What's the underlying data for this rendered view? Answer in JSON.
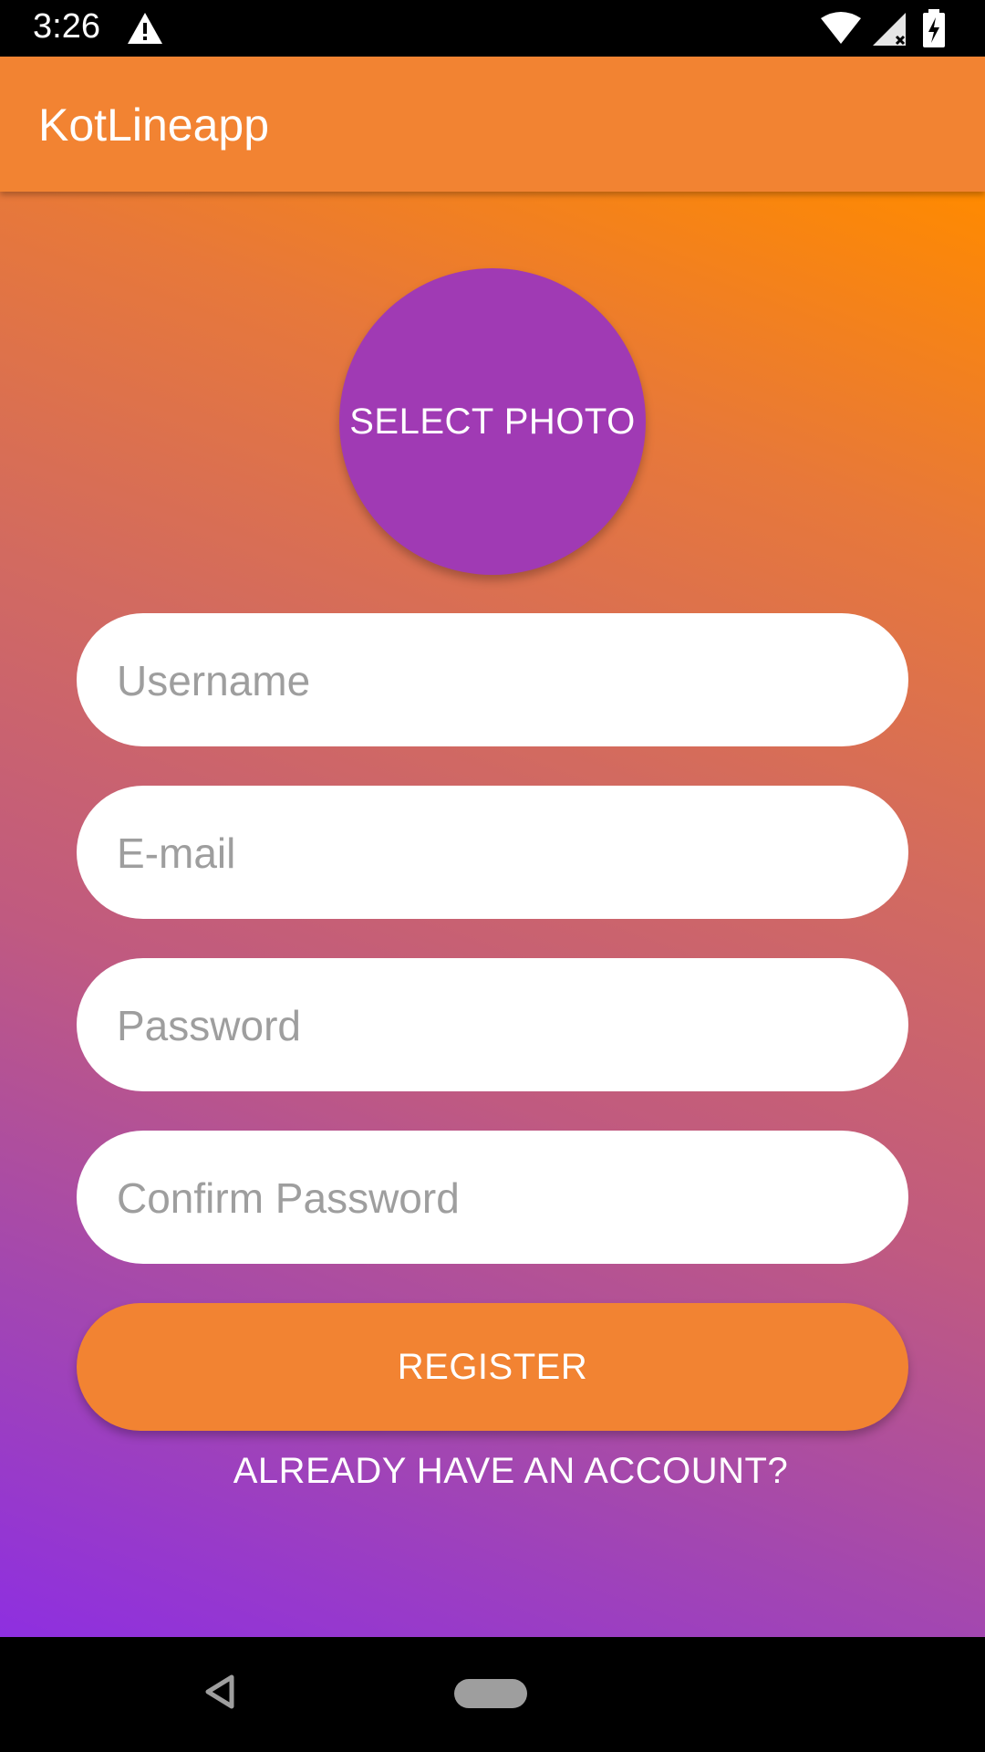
{
  "status_bar": {
    "time": "3:26",
    "icons": [
      "warning-icon",
      "wifi-icon",
      "signal-icon",
      "battery-charging-icon"
    ]
  },
  "app_bar": {
    "title": "KotLineapp"
  },
  "form": {
    "select_photo_label": "SELECT PHOTO",
    "username_placeholder": "Username",
    "email_placeholder": "E-mail",
    "password_placeholder": "Password",
    "confirm_password_placeholder": "Confirm Password",
    "register_label": "REGISTER",
    "login_link_label": "ALREADY HAVE AN ACCOUNT?"
  },
  "colors": {
    "accent": "#F28332",
    "photo_button": "#A03AB4",
    "gradient_top": "#FF8A00",
    "gradient_bottom": "#8E2FE0"
  },
  "nav_bar": {
    "icons": [
      "back-icon",
      "home-pill-icon"
    ]
  }
}
